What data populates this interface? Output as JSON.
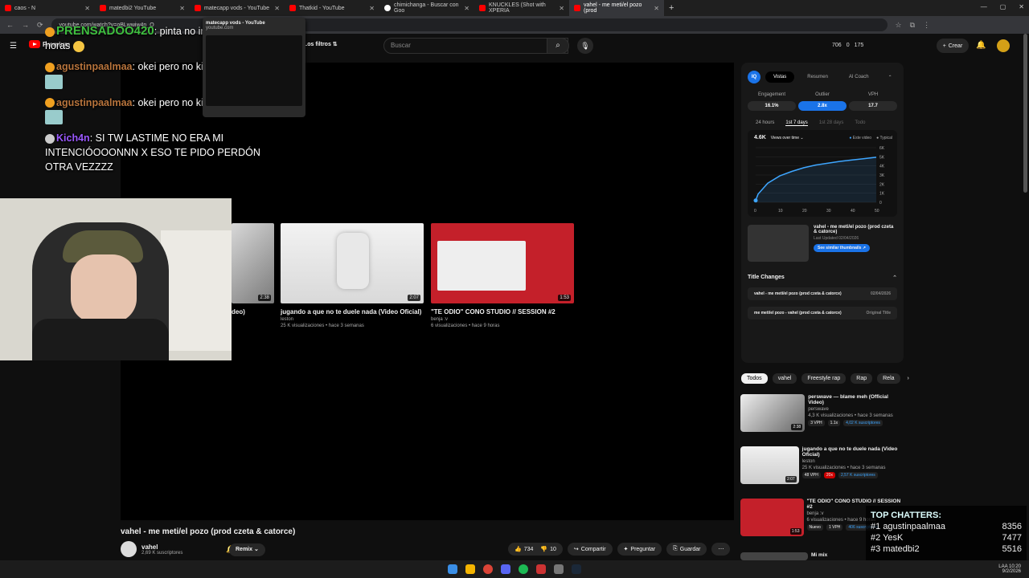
{
  "browser": {
    "tabs": [
      {
        "label": "caos - N"
      },
      {
        "label": "matedbi2 YouTube"
      },
      {
        "label": "matecapp vods - YouTube"
      },
      {
        "label": "Thatkid - YouTube"
      },
      {
        "label": "chimichanga - Buscar con Goo"
      },
      {
        "label": "KNUCKLES (Shot with XPERIA"
      },
      {
        "label": "vahel - me meti/el pozo (prod"
      }
    ],
    "url": "youtube.com/watch?v=oBLwwiw4n_Q",
    "hover_preview": {
      "title": "matecapp vods - YouTube",
      "url": "youtube.com"
    }
  },
  "header": {
    "logo_label": "Premium",
    "filters_label": "Los filtros",
    "search_placeholder": "Buscar",
    "stats": [
      "706",
      "0",
      "175"
    ],
    "create_label": "Crear"
  },
  "end_cards": [
    {
      "title": "deo)",
      "duration": "2:38",
      "meta": "",
      "channel": ""
    },
    {
      "title": "jugando a que no te duele nada (Video Oficial)",
      "channel": "leston",
      "meta": "25 K visualizaciones • hace 3 semanas",
      "duration": "2:07"
    },
    {
      "title": "\"TE ODIO\" CONO STUDIO // SESSION #2",
      "channel": "benja :v",
      "meta": "6 visualizaciones • hace 9 horas",
      "duration": "1:53"
    }
  ],
  "video": {
    "title": "vahel - me meti/el pozo (prod czeta & catorce)",
    "channel": "vahel",
    "subscribers": "2,69 K suscriptores",
    "remix_label": "Remix",
    "likes": "734",
    "dislikes": "10",
    "share_label": "Compartir",
    "ask_label": "Preguntar",
    "save_label": "Guardar"
  },
  "analytics": {
    "tabs": [
      "Vistas",
      "Resumen",
      "AI Coach"
    ],
    "metrics": [
      {
        "label": "Engagement",
        "value": "16.1%"
      },
      {
        "label": "Outlier",
        "value": "2.8x"
      },
      {
        "label": "VPH",
        "value": "17.7"
      }
    ],
    "ranges": [
      "24 hours",
      "1st 7 days",
      "1st 28 days",
      "Todo"
    ],
    "views_total": "4.6K",
    "views_dropdown": "Views over time",
    "legend": [
      "Este video",
      "Typical"
    ],
    "thumb_title": "vahel - me meti/el pozo (prod czeta & catorce)",
    "thumb_updated": "Last Updated 02/04/2026",
    "similar_btn": "See similar thumbnails",
    "title_changes_label": "Title Changes",
    "title_changes": [
      {
        "title": "vahel - me meti/el pozo (prod czeta & catorce)",
        "date": "02/04/2026"
      },
      {
        "title": "me meti/el pozo - vahel (prod czeta & catorce)",
        "date": "Original Title"
      }
    ]
  },
  "chart_data": {
    "type": "line",
    "x": [
      0,
      1,
      3,
      5,
      10,
      15,
      20,
      25,
      30,
      35,
      40,
      45,
      50
    ],
    "series": [
      {
        "name": "Este video",
        "values": [
          200,
          900,
          1500,
          2100,
          2900,
          3400,
          3800,
          4100,
          4300,
          4500,
          4650,
          4800,
          4950
        ]
      }
    ],
    "xticks": [
      "0",
      "10",
      "20",
      "30",
      "40",
      "50"
    ],
    "yticks": [
      "0",
      "1K",
      "2K",
      "3K",
      "4K",
      "5K",
      "6K"
    ],
    "xlim": [
      0,
      50
    ],
    "ylim": [
      0,
      6000
    ]
  },
  "chips": [
    "Todos",
    "vahel",
    "Freestyle rap",
    "Rap",
    "Rela"
  ],
  "sidebar": [
    {
      "title": "perswave — blame meh (Official Video)",
      "channel": "perswave",
      "meta": "4,3 K visualizaciones • hace 3 semanas",
      "duration": "2:38",
      "tags": [
        "3 VPH",
        "1.1x",
        "4,02 K suscriptores"
      ]
    },
    {
      "title": "jugando a que no te duele nada (Video Oficial)",
      "channel": "leston",
      "meta": "25 K visualizaciones • hace 3 semanas",
      "duration": "2:07",
      "tags": [
        "48 VPH",
        "20x",
        "2,57 K suscriptores"
      ]
    },
    {
      "title": "\"TE ODIO\" CONO STUDIO // SESSION #2",
      "channel": "benja :v",
      "meta": "6 visualizaciones • hace 9 horas",
      "duration": "1:53",
      "tags": [
        "Nuevo",
        "1 VPH",
        "406 suscriptores"
      ]
    },
    {
      "title": "Mi mix",
      "channel": "",
      "meta": "",
      "duration": "",
      "tags": []
    }
  ],
  "chat": [
    {
      "user": "PRENSADOO420",
      "text": "pinta no irte yhacer 24 horas"
    },
    {
      "user": "agustinpaalmaa",
      "text": "okei pero no kiero irme"
    },
    {
      "user": "agustinpaalmaa",
      "text": "okei pero no kiero irme"
    },
    {
      "user": "Kich4n",
      "text": "SI TW LASTIME NO ERA MI INTENCIÓOOONNN X ESO TE PIDO PERDÓN OTRA VEZZZZ"
    }
  ],
  "top_chatters": {
    "title": "TOP CHATTERS:",
    "rows": [
      {
        "rank": "#1",
        "name": "agustinpaalmaa",
        "count": "8356"
      },
      {
        "rank": "#2",
        "name": "YesK",
        "count": "7477"
      },
      {
        "rank": "#3",
        "name": "matedbi2",
        "count": "5516"
      }
    ]
  },
  "tray": {
    "lang": "LAA",
    "time": "10:20",
    "date": "9/2/2026"
  },
  "colors": {
    "yt_red": "#ff0000",
    "accent": "#1a73e8",
    "bg": "#0f0f0f"
  }
}
